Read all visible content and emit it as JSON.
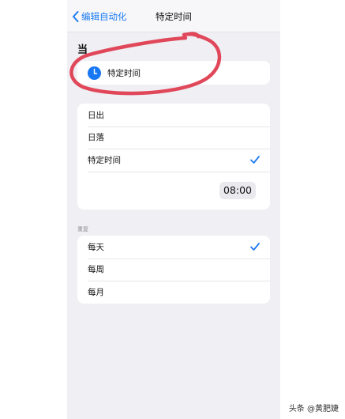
{
  "nav": {
    "back_label": "编辑自动化",
    "title": "特定时间"
  },
  "section": {
    "header": "当",
    "selected_label": "特定时间"
  },
  "options": [
    {
      "label": "日出",
      "checked": false
    },
    {
      "label": "日落",
      "checked": false
    },
    {
      "label": "特定时间",
      "checked": true
    }
  ],
  "time_value": "08:00",
  "repeat": {
    "header": "重复",
    "items": [
      {
        "label": "每天",
        "checked": true
      },
      {
        "label": "每周",
        "checked": false
      },
      {
        "label": "每月",
        "checked": false
      }
    ]
  },
  "watermark": "头条 @黄肥婕",
  "colors": {
    "accent": "#1d7bf0",
    "annotation": "#e0485a"
  },
  "icons": {
    "back": "chevron-left-icon",
    "clock": "clock-icon",
    "check": "checkmark-icon"
  }
}
